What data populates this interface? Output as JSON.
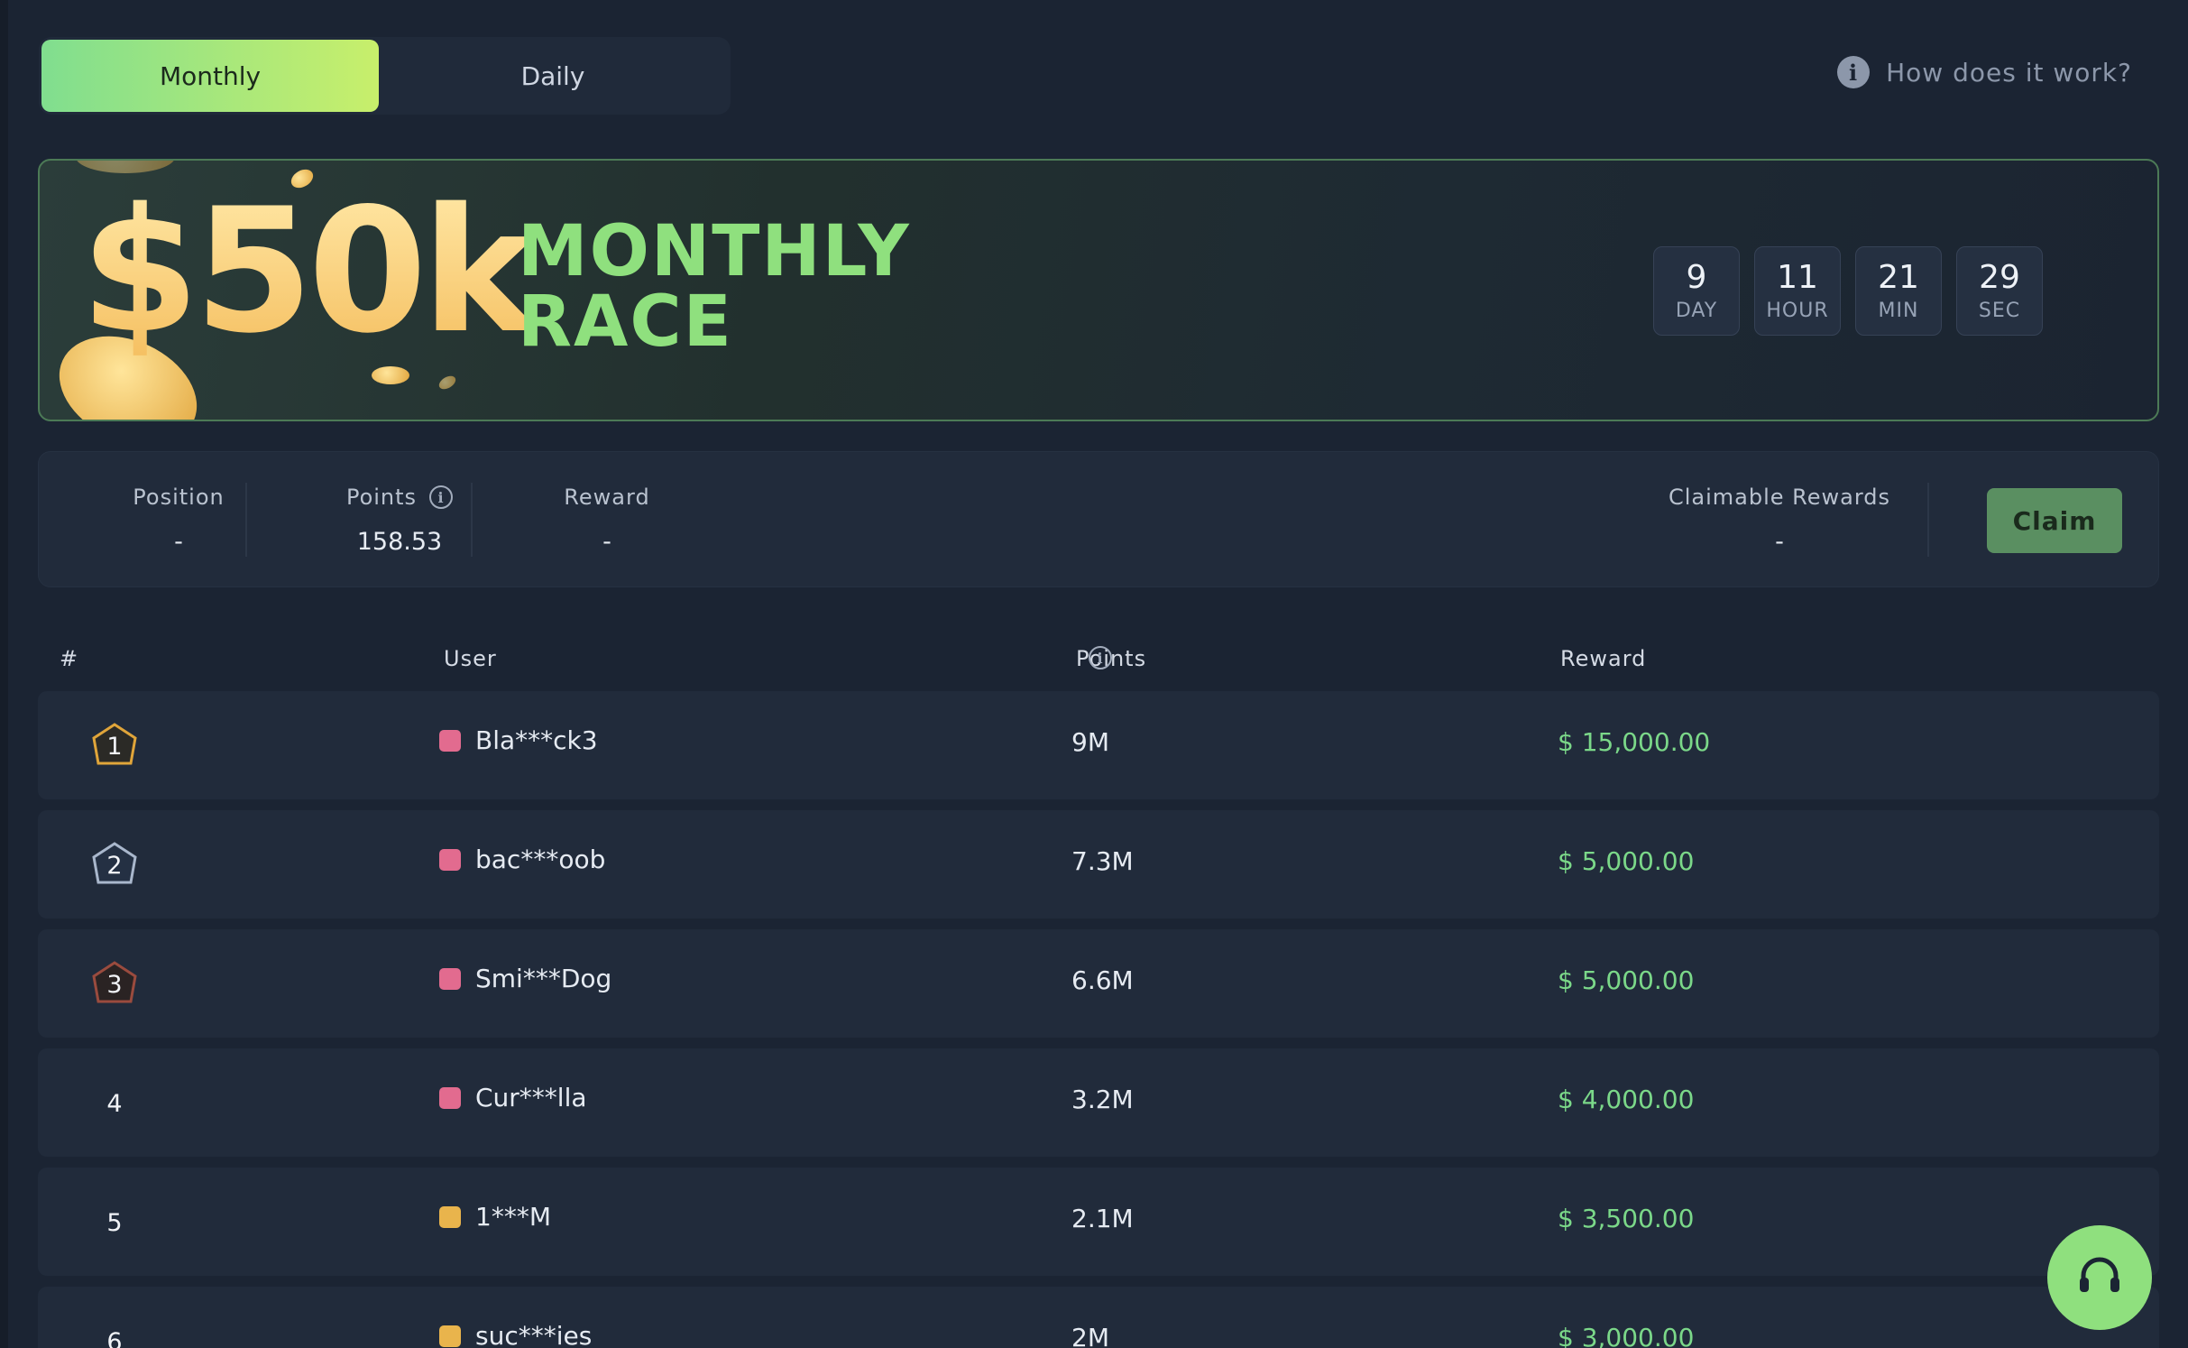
{
  "tabs": [
    {
      "label": "Monthly",
      "active": true
    },
    {
      "label": "Daily",
      "active": false
    }
  ],
  "how_it_works": "How does it work?",
  "banner": {
    "amount": "$50k",
    "title_line1": "MONTHLY",
    "title_line2": "RACE",
    "countdown": [
      {
        "value": "9",
        "unit": "DAY"
      },
      {
        "value": "11",
        "unit": "HOUR"
      },
      {
        "value": "21",
        "unit": "MIN"
      },
      {
        "value": "29",
        "unit": "SEC"
      }
    ]
  },
  "stats": {
    "position_label": "Position",
    "position_value": "-",
    "points_label": "Points",
    "points_value": "158.53",
    "reward_label": "Reward",
    "reward_value": "-",
    "claimable_label": "Claimable Rewards",
    "claimable_value": "-",
    "claim_button": "Claim"
  },
  "table": {
    "headers": {
      "rank": "#",
      "user": "User",
      "points": "Points",
      "reward": "Reward"
    },
    "rows": [
      {
        "rank": "1",
        "user": "Bla***ck3",
        "points": "9M",
        "reward": "$ 15,000.00"
      },
      {
        "rank": "2",
        "user": "bac***oob",
        "points": "7.3M",
        "reward": "$ 5,000.00"
      },
      {
        "rank": "3",
        "user": "Smi***Dog",
        "points": "6.6M",
        "reward": "$ 5,000.00"
      },
      {
        "rank": "4",
        "user": "Cur***lla",
        "points": "3.2M",
        "reward": "$ 4,000.00"
      },
      {
        "rank": "5",
        "user": "1***M",
        "points": "2.1M",
        "reward": "$ 3,500.00"
      },
      {
        "rank": "6",
        "user": "suc***ies",
        "points": "2M",
        "reward": "$ 3,000.00"
      }
    ]
  },
  "colors": {
    "accent_green": "#8fe07e",
    "reward_green": "#7bd889",
    "background": "#1b2433",
    "gold": "#f5c062"
  }
}
